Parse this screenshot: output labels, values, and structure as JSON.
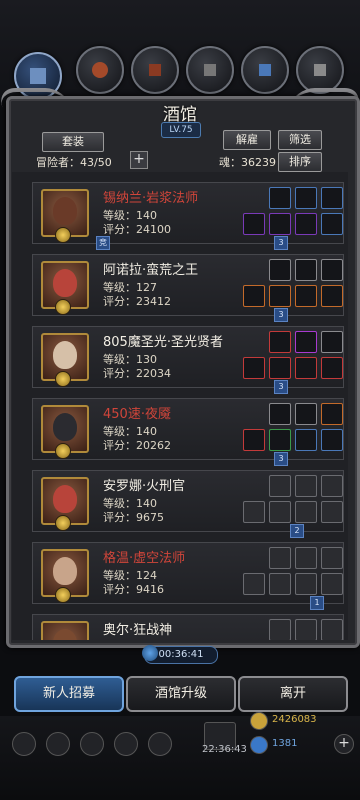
{
  "header": {
    "title": "酒馆",
    "level": "LV.75"
  },
  "toolbar": {
    "suit": "套装",
    "dismiss": "解雇",
    "filter": "筛选",
    "sort": "排序",
    "plus": "+"
  },
  "stats": {
    "adventurers_label": "冒险者：",
    "adventurers_value": "43/50",
    "soul_label": "魂：",
    "soul_value": "36239"
  },
  "heroes": [
    {
      "name": "锡纳兰·岩浆法师",
      "name_color": "#d0453a",
      "level_label": "等级：",
      "level": "140",
      "score_label": "评分：",
      "score": "24100",
      "tag": "竞"
    },
    {
      "name": "阿诺拉·蛮荒之王",
      "name_color": "#f2eee4",
      "level_label": "等级：",
      "level": "127",
      "score_label": "评分：",
      "score": "23412",
      "tag": "3"
    },
    {
      "name": "805魔圣光·圣光贤者",
      "name_color": "#f2eee4",
      "level_label": "等级：",
      "level": "130",
      "score_label": "评分：",
      "score": "22034",
      "tag": "3"
    },
    {
      "name": "450速·夜魇",
      "name_color": "#d0453a",
      "level_label": "等级：",
      "level": "140",
      "score_label": "评分：",
      "score": "20262",
      "tag": "3"
    },
    {
      "name": "安罗娜·火刑官",
      "name_color": "#f2eee4",
      "level_label": "等级：",
      "level": "140",
      "score_label": "评分：",
      "score": "9675",
      "tag": "3"
    },
    {
      "name": "格温·虚空法师",
      "name_color": "#d0453a",
      "level_label": "等级：",
      "level": "124",
      "score_label": "评分：",
      "score": "9416",
      "tag": "2"
    },
    {
      "name": "奥尔·狂战神",
      "name_color": "#f2eee4",
      "level_label": "等级：",
      "level": "",
      "score_label": "评分：",
      "score": "",
      "tag": "1"
    }
  ],
  "timer": {
    "value": "00:36:41"
  },
  "buttons": {
    "recruit": "新人招募",
    "upgrade": "酒馆升级",
    "leave": "离开"
  },
  "dock": {
    "time": "22:36:43",
    "gold": "2426083",
    "gems": "1381"
  },
  "colors": {
    "accent_blue": "#4a73a6",
    "gold": "#b08a3a",
    "red_name": "#d0453a"
  }
}
